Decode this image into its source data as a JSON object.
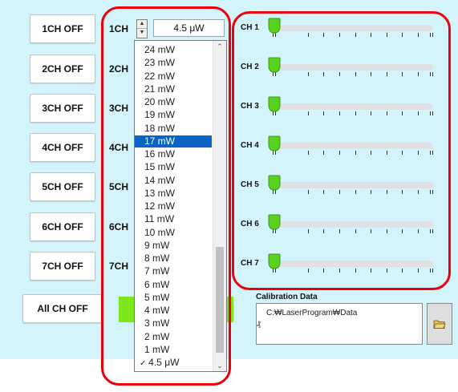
{
  "buttons": [
    {
      "label": "1CH OFF"
    },
    {
      "label": "2CH OFF"
    },
    {
      "label": "3CH OFF"
    },
    {
      "label": "4CH OFF"
    },
    {
      "label": "5CH OFF"
    },
    {
      "label": "6CH OFF"
    },
    {
      "label": "7CH OFF"
    }
  ],
  "all_button": {
    "label": "All CH OFF"
  },
  "row_labels": [
    "1CH",
    "2CH",
    "3CH",
    "4CH",
    "5CH",
    "6CH",
    "7CH"
  ],
  "power_select": {
    "value": "4.5 μW",
    "selected": "17 mW",
    "checked": "4.5 μW",
    "options": [
      "24 mW",
      "23 mW",
      "22 mW",
      "21 mW",
      "20 mW",
      "19 mW",
      "18 mW",
      "17 mW",
      "16 mW",
      "15 mW",
      "14 mW",
      "13 mW",
      "12 mW",
      "11 mW",
      "10 mW",
      "9 mW",
      "8 mW",
      "7 mW",
      "6 mW",
      "5 mW",
      "4 mW",
      "3 mW",
      "2 mW",
      "1 mW",
      "4.5 μW"
    ]
  },
  "sliders": [
    {
      "label": "CH 1",
      "value": 0
    },
    {
      "label": "CH 2",
      "value": 0
    },
    {
      "label": "CH 3",
      "value": 0
    },
    {
      "label": "CH 4",
      "value": 0
    },
    {
      "label": "CH 5",
      "value": 0
    },
    {
      "label": "CH 6",
      "value": 0
    },
    {
      "label": "CH 7",
      "value": 0
    }
  ],
  "calibration": {
    "title": "Calibration Data",
    "path": "C:\\LaserProgram\\Data",
    "path_display": "C:₩LaserProgram₩Data",
    "marker": "₰"
  },
  "icons": {
    "folder": "folder-open-icon",
    "scroll_up": "chevron-up-icon",
    "scroll_down": "chevron-down-icon",
    "check": "checkmark-icon"
  },
  "colors": {
    "panel": "#d4f4fc",
    "highlight": "#0b63c4",
    "thumb_green": "#58d21c",
    "annotation": "#e8000b",
    "on_indicator": "#7ce81c"
  }
}
